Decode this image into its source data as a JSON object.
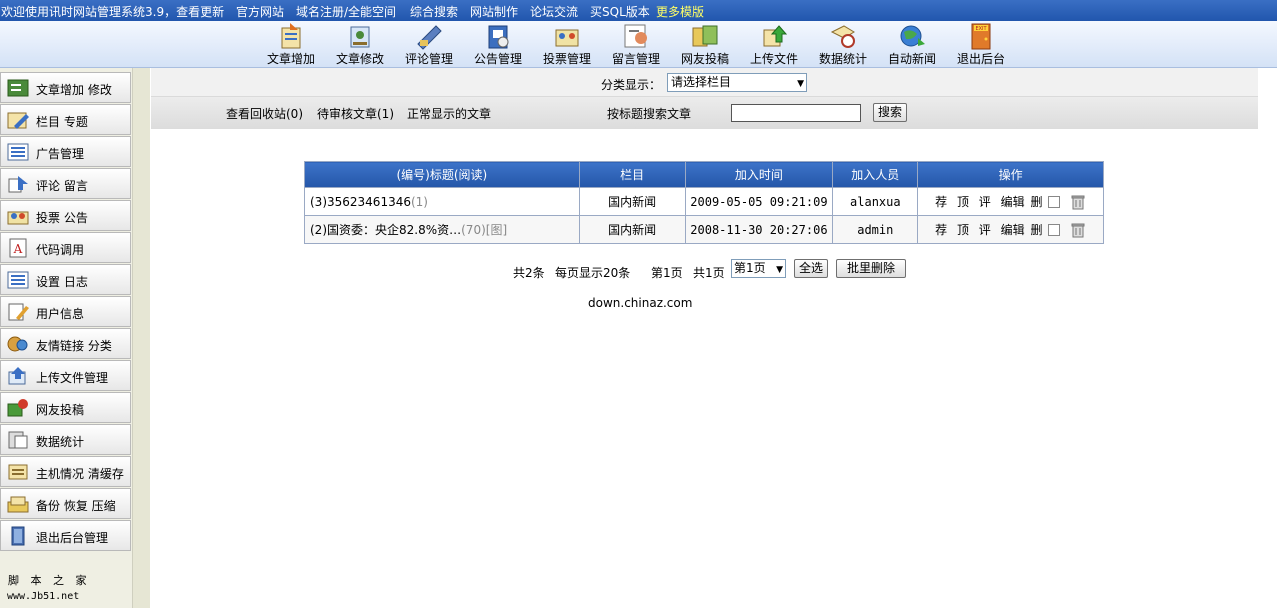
{
  "topbar": {
    "links": [
      "欢迎使用讯时网站管理系统3.9，查看更新",
      "官方网站",
      "域名注册/全能空间",
      "综合搜索",
      "网站制作",
      "论坛交流",
      "买SQL版本",
      "更多模版"
    ],
    "highlight_color": "#ffff66"
  },
  "toolbar": {
    "items": [
      {
        "label": "文章增加",
        "icon": "article-add-icon"
      },
      {
        "label": "文章修改",
        "icon": "article-edit-icon"
      },
      {
        "label": "评论管理",
        "icon": "comment-icon"
      },
      {
        "label": "公告管理",
        "icon": "notice-icon"
      },
      {
        "label": "投票管理",
        "icon": "vote-icon"
      },
      {
        "label": "留言管理",
        "icon": "message-icon"
      },
      {
        "label": "网友投稿",
        "icon": "submission-icon"
      },
      {
        "label": "上传文件",
        "icon": "upload-icon"
      },
      {
        "label": "数据统计",
        "icon": "stats-icon"
      },
      {
        "label": "自动新闻",
        "icon": "globe-icon"
      },
      {
        "label": "退出后台",
        "icon": "exit-door-icon"
      }
    ],
    "exit_sign": "EXIT"
  },
  "sidebar": {
    "items": [
      {
        "label": "文章增加  修改",
        "icon": "article-add-icon"
      },
      {
        "label": "栏目  专题",
        "icon": "column-icon"
      },
      {
        "label": "广告管理",
        "icon": "ad-icon"
      },
      {
        "label": "评论  留言",
        "icon": "comment-icon"
      },
      {
        "label": "投票  公告",
        "icon": "vote-icon"
      },
      {
        "label": "代码调用",
        "icon": "code-icon"
      },
      {
        "label": "设置  日志",
        "icon": "settings-icon"
      },
      {
        "label": "用户信息",
        "icon": "user-icon"
      },
      {
        "label": "友情链接  分类",
        "icon": "link-icon"
      },
      {
        "label": "上传文件管理",
        "icon": "upload-icon"
      },
      {
        "label": "网友投稿",
        "icon": "submission-icon"
      },
      {
        "label": "数据统计",
        "icon": "stats-icon"
      },
      {
        "label": "主机情况  清缓存",
        "icon": "server-icon"
      },
      {
        "label": "备份  恢复  压缩",
        "icon": "backup-icon"
      },
      {
        "label": "退出后台管理",
        "icon": "exit-icon"
      }
    ],
    "brand": "脚 本 之 家",
    "brand_url": "www.Jb51.net"
  },
  "filter": {
    "label": "分类显示：",
    "select_value": "请选择栏目"
  },
  "actions": {
    "recycle": "查看回收站(0)",
    "pending": "待审核文章(1)",
    "normal": "正常显示的文章",
    "search_label": "按标题搜索文章",
    "search_value": "",
    "search_button": "搜索"
  },
  "table": {
    "headers": [
      "(编号)标题(阅读)",
      "栏目",
      "加入时间",
      "加入人员",
      "操作"
    ],
    "rows": [
      {
        "id_title": "(3)35623461346",
        "reads": "(1)",
        "tag": "",
        "column": "国内新闻",
        "time": "2009-05-05 09:21:09",
        "user": "alanxua"
      },
      {
        "id_title": "(2)国资委：央企82.8%资…",
        "reads": "(70)",
        "tag": "[图]",
        "column": "国内新闻",
        "time": "2008-11-30 20:27:06",
        "user": "admin"
      }
    ],
    "ops": [
      "荐",
      "顶",
      "评",
      "编辑",
      "删"
    ]
  },
  "pager": {
    "total": "共2条",
    "per_page": "每页显示20条",
    "current": "第1页",
    "pages": "共1页",
    "select_value": "第1页",
    "select_all": "全选",
    "batch_delete": "批里删除"
  },
  "footer": {
    "url": "down.chinaz.com"
  }
}
